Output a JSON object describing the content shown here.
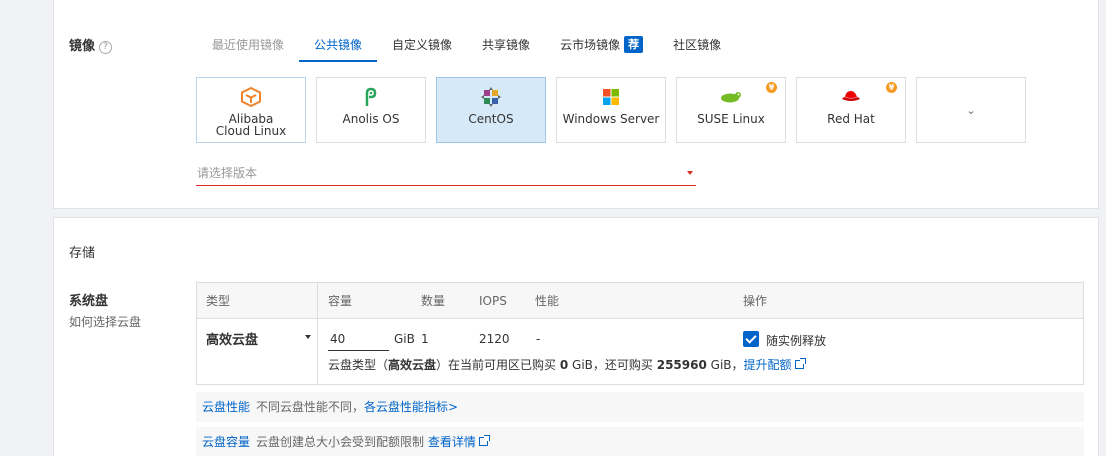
{
  "image_section": {
    "label": "镜像",
    "help": "?",
    "tabs": [
      {
        "label": "最近使用镜像"
      },
      {
        "label": "公共镜像"
      },
      {
        "label": "自定义镜像"
      },
      {
        "label": "共享镜像"
      },
      {
        "label": "云市场镜像",
        "badge": "荐"
      },
      {
        "label": "社区镜像"
      }
    ],
    "os_tiles": [
      {
        "name": "Alibaba Cloud Linux"
      },
      {
        "name": "Anolis OS"
      },
      {
        "name": "CentOS"
      },
      {
        "name": "Windows Server"
      },
      {
        "name": "SUSE Linux",
        "badge": "¥"
      },
      {
        "name": "Red Hat",
        "badge": "¥"
      }
    ],
    "more_glyph": "⌄",
    "version_placeholder": "请选择版本",
    "colors": {
      "accent": "#0064c8",
      "error": "#d93026",
      "selected_bg": "#d6e9f8"
    }
  },
  "storage": {
    "title": "存储",
    "system_disk": {
      "label": "系统盘",
      "help_link": "如何选择云盘",
      "headers": {
        "type": "类型",
        "capacity": "容量",
        "count": "数量",
        "iops": "IOPS",
        "performance": "性能",
        "action": "操作"
      },
      "row": {
        "type": "高效云盘",
        "capacity": "40",
        "unit": "GiB",
        "count": "1",
        "iops": "2120",
        "performance": "-",
        "release_label": "随实例释放",
        "release_checked": true
      },
      "info": {
        "prefix": "云盘类型（",
        "type": "高效云盘",
        "mid1": "）在当前可用区已购买 ",
        "purchased": "0",
        "mid2": " GiB，还可购买 ",
        "remaining": "255960",
        "mid3": " GiB，",
        "link": "提升配额"
      }
    },
    "notes": [
      {
        "tag": "云盘性能",
        "text": "不同云盘性能不同，",
        "link": "各云盘性能指标>"
      },
      {
        "tag": "云盘容量",
        "text": "云盘创建总大小会受到配额限制",
        "link": "查看详情"
      }
    ]
  }
}
